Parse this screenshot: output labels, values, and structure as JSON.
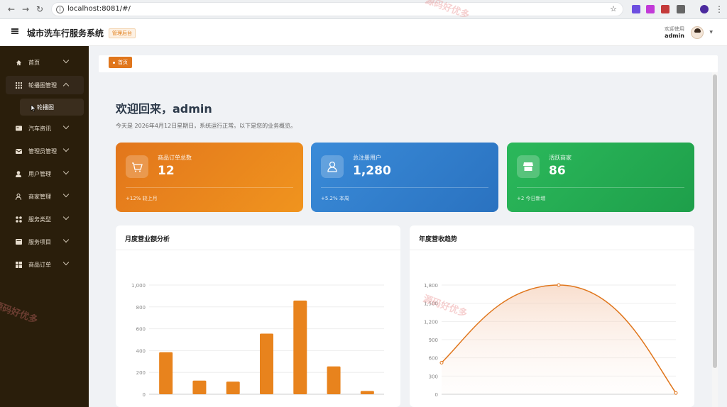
{
  "browser": {
    "url": "localhost:8081/#/"
  },
  "header": {
    "title": "城市洗车行服务系统",
    "badge": "管理后台",
    "welcome": "欢迎使用",
    "user": "admin"
  },
  "sidebar": {
    "items": [
      {
        "label": "首页",
        "icon": "home-icon"
      },
      {
        "label": "轮播图管理",
        "icon": "grid-icon"
      },
      {
        "label": "汽车资讯",
        "icon": "card-icon"
      },
      {
        "label": "管理员管理",
        "icon": "mail-icon"
      },
      {
        "label": "用户管理",
        "icon": "user-icon"
      },
      {
        "label": "商家管理",
        "icon": "person-icon"
      },
      {
        "label": "服务类型",
        "icon": "apps-icon"
      },
      {
        "label": "服务项目",
        "icon": "list-icon"
      },
      {
        "label": "商品订单",
        "icon": "tiles-icon"
      }
    ],
    "sub_item": "轮播图"
  },
  "tabs": {
    "home": "首页"
  },
  "main": {
    "welcome": "欢迎回来，admin",
    "subtitle": "今天是 2026年4月12日星期日，系统运行正常。以下是您的业务概览。",
    "cards": [
      {
        "title": "商品订单总数",
        "value": "12",
        "footer": "+12% 较上月",
        "icon": "cart-icon",
        "color": "#e8831d"
      },
      {
        "title": "总注册用户",
        "value": "1,280",
        "footer": "+5.2% 本周",
        "icon": "user-outline-icon",
        "color": "#3181cf"
      },
      {
        "title": "活跃商家",
        "value": "86",
        "footer": "+2 今日新增",
        "icon": "store-icon",
        "color": "#25ad54"
      }
    ]
  },
  "charts": {
    "monthly_title": "月度营业额分析",
    "yearly_title": "年度营收趋势"
  },
  "watermark": "源码好优多",
  "chart_data": [
    {
      "type": "bar",
      "title": "月度营业额分析",
      "values": [
        385,
        125,
        115,
        555,
        858,
        255,
        30
      ],
      "ylim": [
        0,
        1000
      ],
      "yticks": [
        "0",
        "200",
        "400",
        "600",
        "800",
        "1,000"
      ],
      "color": "#e8831d"
    },
    {
      "type": "area",
      "title": "年度营收趋势",
      "x": [
        0,
        1,
        2
      ],
      "y": [
        520,
        1800,
        20
      ],
      "ylim": [
        0,
        1800
      ],
      "yticks": [
        "0",
        "300",
        "600",
        "900",
        "1,200",
        "1,500",
        "1,800"
      ],
      "color": "#e0761c"
    }
  ]
}
